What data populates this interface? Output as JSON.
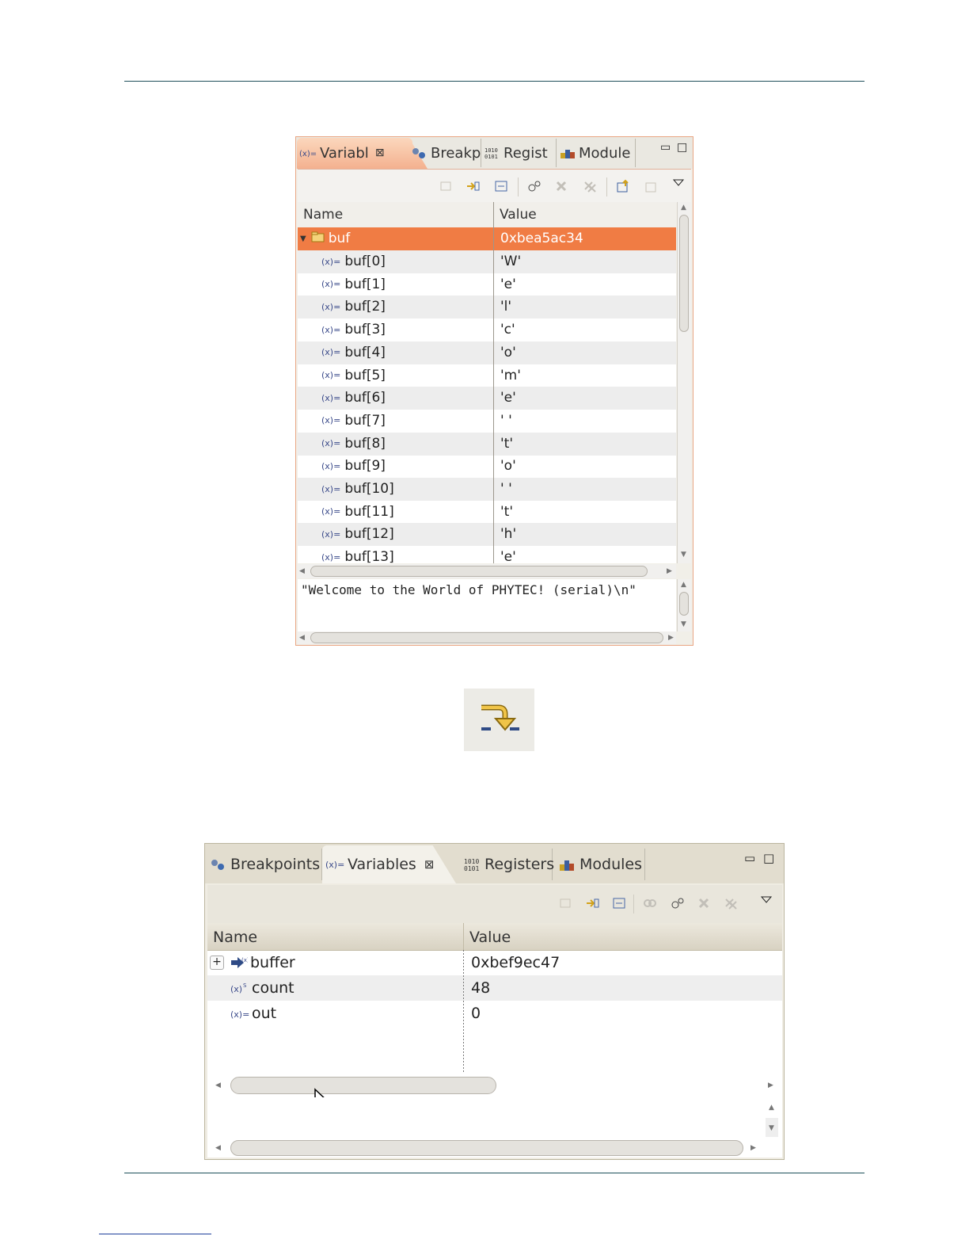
{
  "panel1": {
    "tabs": [
      {
        "label": "Variabl",
        "icon": "variables-icon",
        "active": true,
        "closable": true
      },
      {
        "label": "Breakp",
        "icon": "breakpoints-icon"
      },
      {
        "label": "Regist",
        "icon": "registers-icon"
      },
      {
        "label": "Module",
        "icon": "modules-icon"
      }
    ],
    "columns": {
      "name": "Name",
      "value": "Value"
    },
    "parent": {
      "name": "buf",
      "value": "0xbea5ac34",
      "icon": "struct-icon",
      "expanded": true
    },
    "rows": [
      {
        "name": "buf[0]",
        "value": "'W'"
      },
      {
        "name": "buf[1]",
        "value": "'e'"
      },
      {
        "name": "buf[2]",
        "value": "'l'"
      },
      {
        "name": "buf[3]",
        "value": "'c'"
      },
      {
        "name": "buf[4]",
        "value": "'o'"
      },
      {
        "name": "buf[5]",
        "value": "'m'"
      },
      {
        "name": "buf[6]",
        "value": "'e'"
      },
      {
        "name": "buf[7]",
        "value": "' '"
      },
      {
        "name": "buf[8]",
        "value": "'t'"
      },
      {
        "name": "buf[9]",
        "value": "'o'"
      },
      {
        "name": "buf[10]",
        "value": "' '"
      },
      {
        "name": "buf[11]",
        "value": "'t'"
      },
      {
        "name": "buf[12]",
        "value": "'h'"
      },
      {
        "name": "buf[13]",
        "value": "'e'"
      }
    ],
    "detail": "\"Welcome to the World of PHYTEC! (serial)\\n\""
  },
  "step_icon": "step-return-icon",
  "panel2": {
    "tabs": [
      {
        "label": "Breakpoints",
        "icon": "breakpoints-icon"
      },
      {
        "label": "Variables",
        "icon": "variables-icon",
        "active": true,
        "closable": true
      },
      {
        "label": "Registers",
        "icon": "registers-icon"
      },
      {
        "label": "Modules",
        "icon": "modules-icon"
      }
    ],
    "columns": {
      "name": "Name",
      "value": "Value"
    },
    "rows": [
      {
        "name": "buffer",
        "value": "0xbef9ec47",
        "expandable": true,
        "icon": "pointer-variable-icon"
      },
      {
        "name": "count",
        "value": "48",
        "icon": "static-variable-icon"
      },
      {
        "name": "out",
        "value": "0",
        "icon": "local-variable-icon"
      }
    ]
  },
  "colors": {
    "selection": "#f07c44",
    "active_tab": "#f4b18f",
    "rule": "#1e4f5a"
  }
}
